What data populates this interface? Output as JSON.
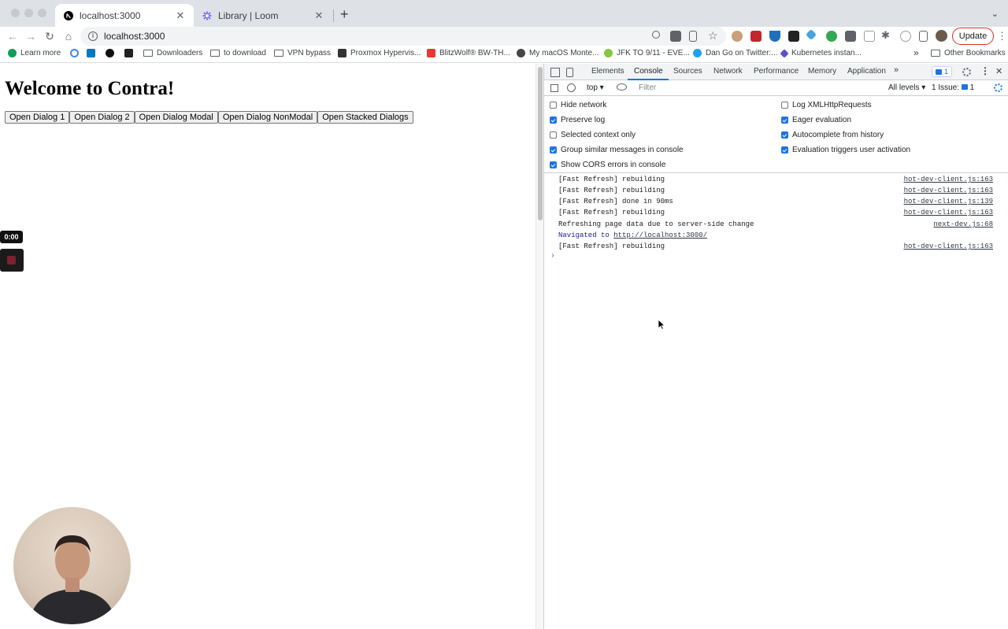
{
  "tabs": [
    {
      "title": "localhost:3000",
      "close": "✕"
    },
    {
      "title": "Library | Loom",
      "close": "✕"
    }
  ],
  "new_tab": "+",
  "tab_menu": "⌄",
  "toolbar": {
    "url": "localhost:3000",
    "update_label": "Update",
    "menu": "⋮"
  },
  "bookmarks": [
    {
      "label": "Learn more",
      "icon": "phone-icon"
    },
    {
      "label": "Downloaders",
      "icon": "folder-icon"
    },
    {
      "label": "to download",
      "icon": "folder-icon"
    },
    {
      "label": "VPN bypass",
      "icon": "folder-icon"
    },
    {
      "label": "Proxmox Hypervis...",
      "icon": "book-icon"
    },
    {
      "label": "BlitzWolf® BW-TH...",
      "icon": "bg-icon"
    },
    {
      "label": "My macOS Monte...",
      "icon": "wordpress-icon"
    },
    {
      "label": "JFK TO 9/11 - EVE...",
      "icon": "rumble-icon"
    },
    {
      "label": "Dan Go on Twitter:...",
      "icon": "twitter-icon"
    },
    {
      "label": "Kubernetes instan...",
      "icon": "diamond-icon"
    },
    {
      "label": "»",
      "icon": ""
    },
    {
      "label": "Other Bookmarks",
      "icon": "folder-icon"
    }
  ],
  "page": {
    "heading": "Welcome to Contra!",
    "buttons": [
      "Open Dialog 1",
      "Open Dialog 2",
      "Open Dialog Modal",
      "Open Dialog NonModal",
      "Open Stacked Dialogs"
    ],
    "timer": "0:00"
  },
  "devtools": {
    "tabs": [
      "Elements",
      "Console",
      "Sources",
      "Network",
      "Performance",
      "Memory",
      "Application"
    ],
    "more": "»",
    "issues_badge": "1",
    "context": "top ▾",
    "filter_placeholder": "Filter",
    "levels": "All levels ▾",
    "issue_count": "1 Issue:",
    "issue_num": "1",
    "settings_left": [
      {
        "label": "Hide network",
        "checked": false
      },
      {
        "label": "Preserve log",
        "checked": true
      },
      {
        "label": "Selected context only",
        "checked": false
      },
      {
        "label": "Group similar messages in console",
        "checked": true
      },
      {
        "label": "Show CORS errors in console",
        "checked": true
      }
    ],
    "settings_right": [
      {
        "label": "Log XMLHttpRequests",
        "checked": false
      },
      {
        "label": "Eager evaluation",
        "checked": true
      },
      {
        "label": "Autocomplete from history",
        "checked": true
      },
      {
        "label": "Evaluation triggers user activation",
        "checked": true
      }
    ],
    "console": [
      {
        "text": "[Fast Refresh] rebuilding",
        "src": "hot-dev-client.js:163"
      },
      {
        "text": "[Fast Refresh] rebuilding",
        "src": "hot-dev-client.js:163"
      },
      {
        "text": "[Fast Refresh] done in 90ms",
        "src": "hot-dev-client.js:139"
      },
      {
        "text": "[Fast Refresh] rebuilding",
        "src": "hot-dev-client.js:163"
      },
      {
        "text": "Refreshing page data due to server-side change",
        "src": "next-dev.js:68"
      },
      {
        "text": "Navigated to ",
        "link": "http://localhost:3000/",
        "src": ""
      },
      {
        "text": "[Fast Refresh] rebuilding",
        "src": "hot-dev-client.js:163"
      }
    ],
    "prompt": "›"
  },
  "colors": {
    "accent": "#1a73e8",
    "update_border": "#d93025"
  }
}
